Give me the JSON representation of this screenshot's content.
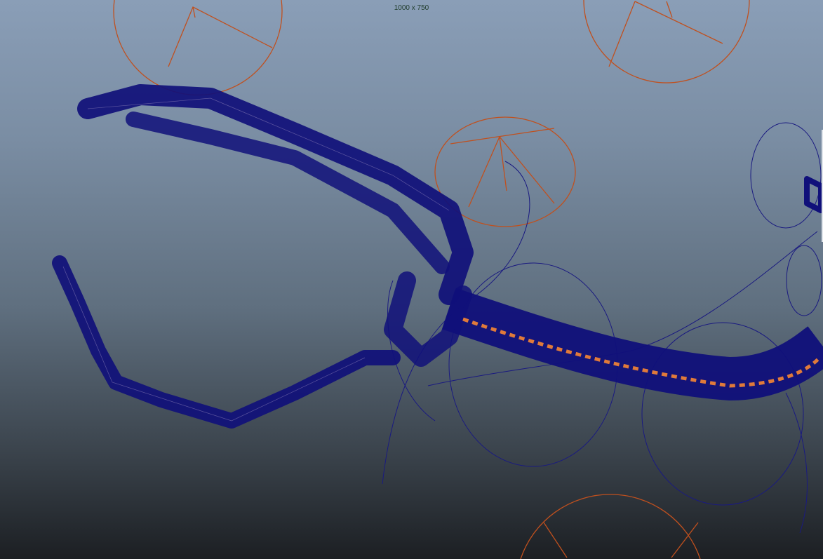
{
  "viewport": {
    "resolution_gate_label": "1000 x 750",
    "wireframe_color": "#12127a",
    "control_color": "#c0501e",
    "joint_color": "#e07a3a"
  }
}
